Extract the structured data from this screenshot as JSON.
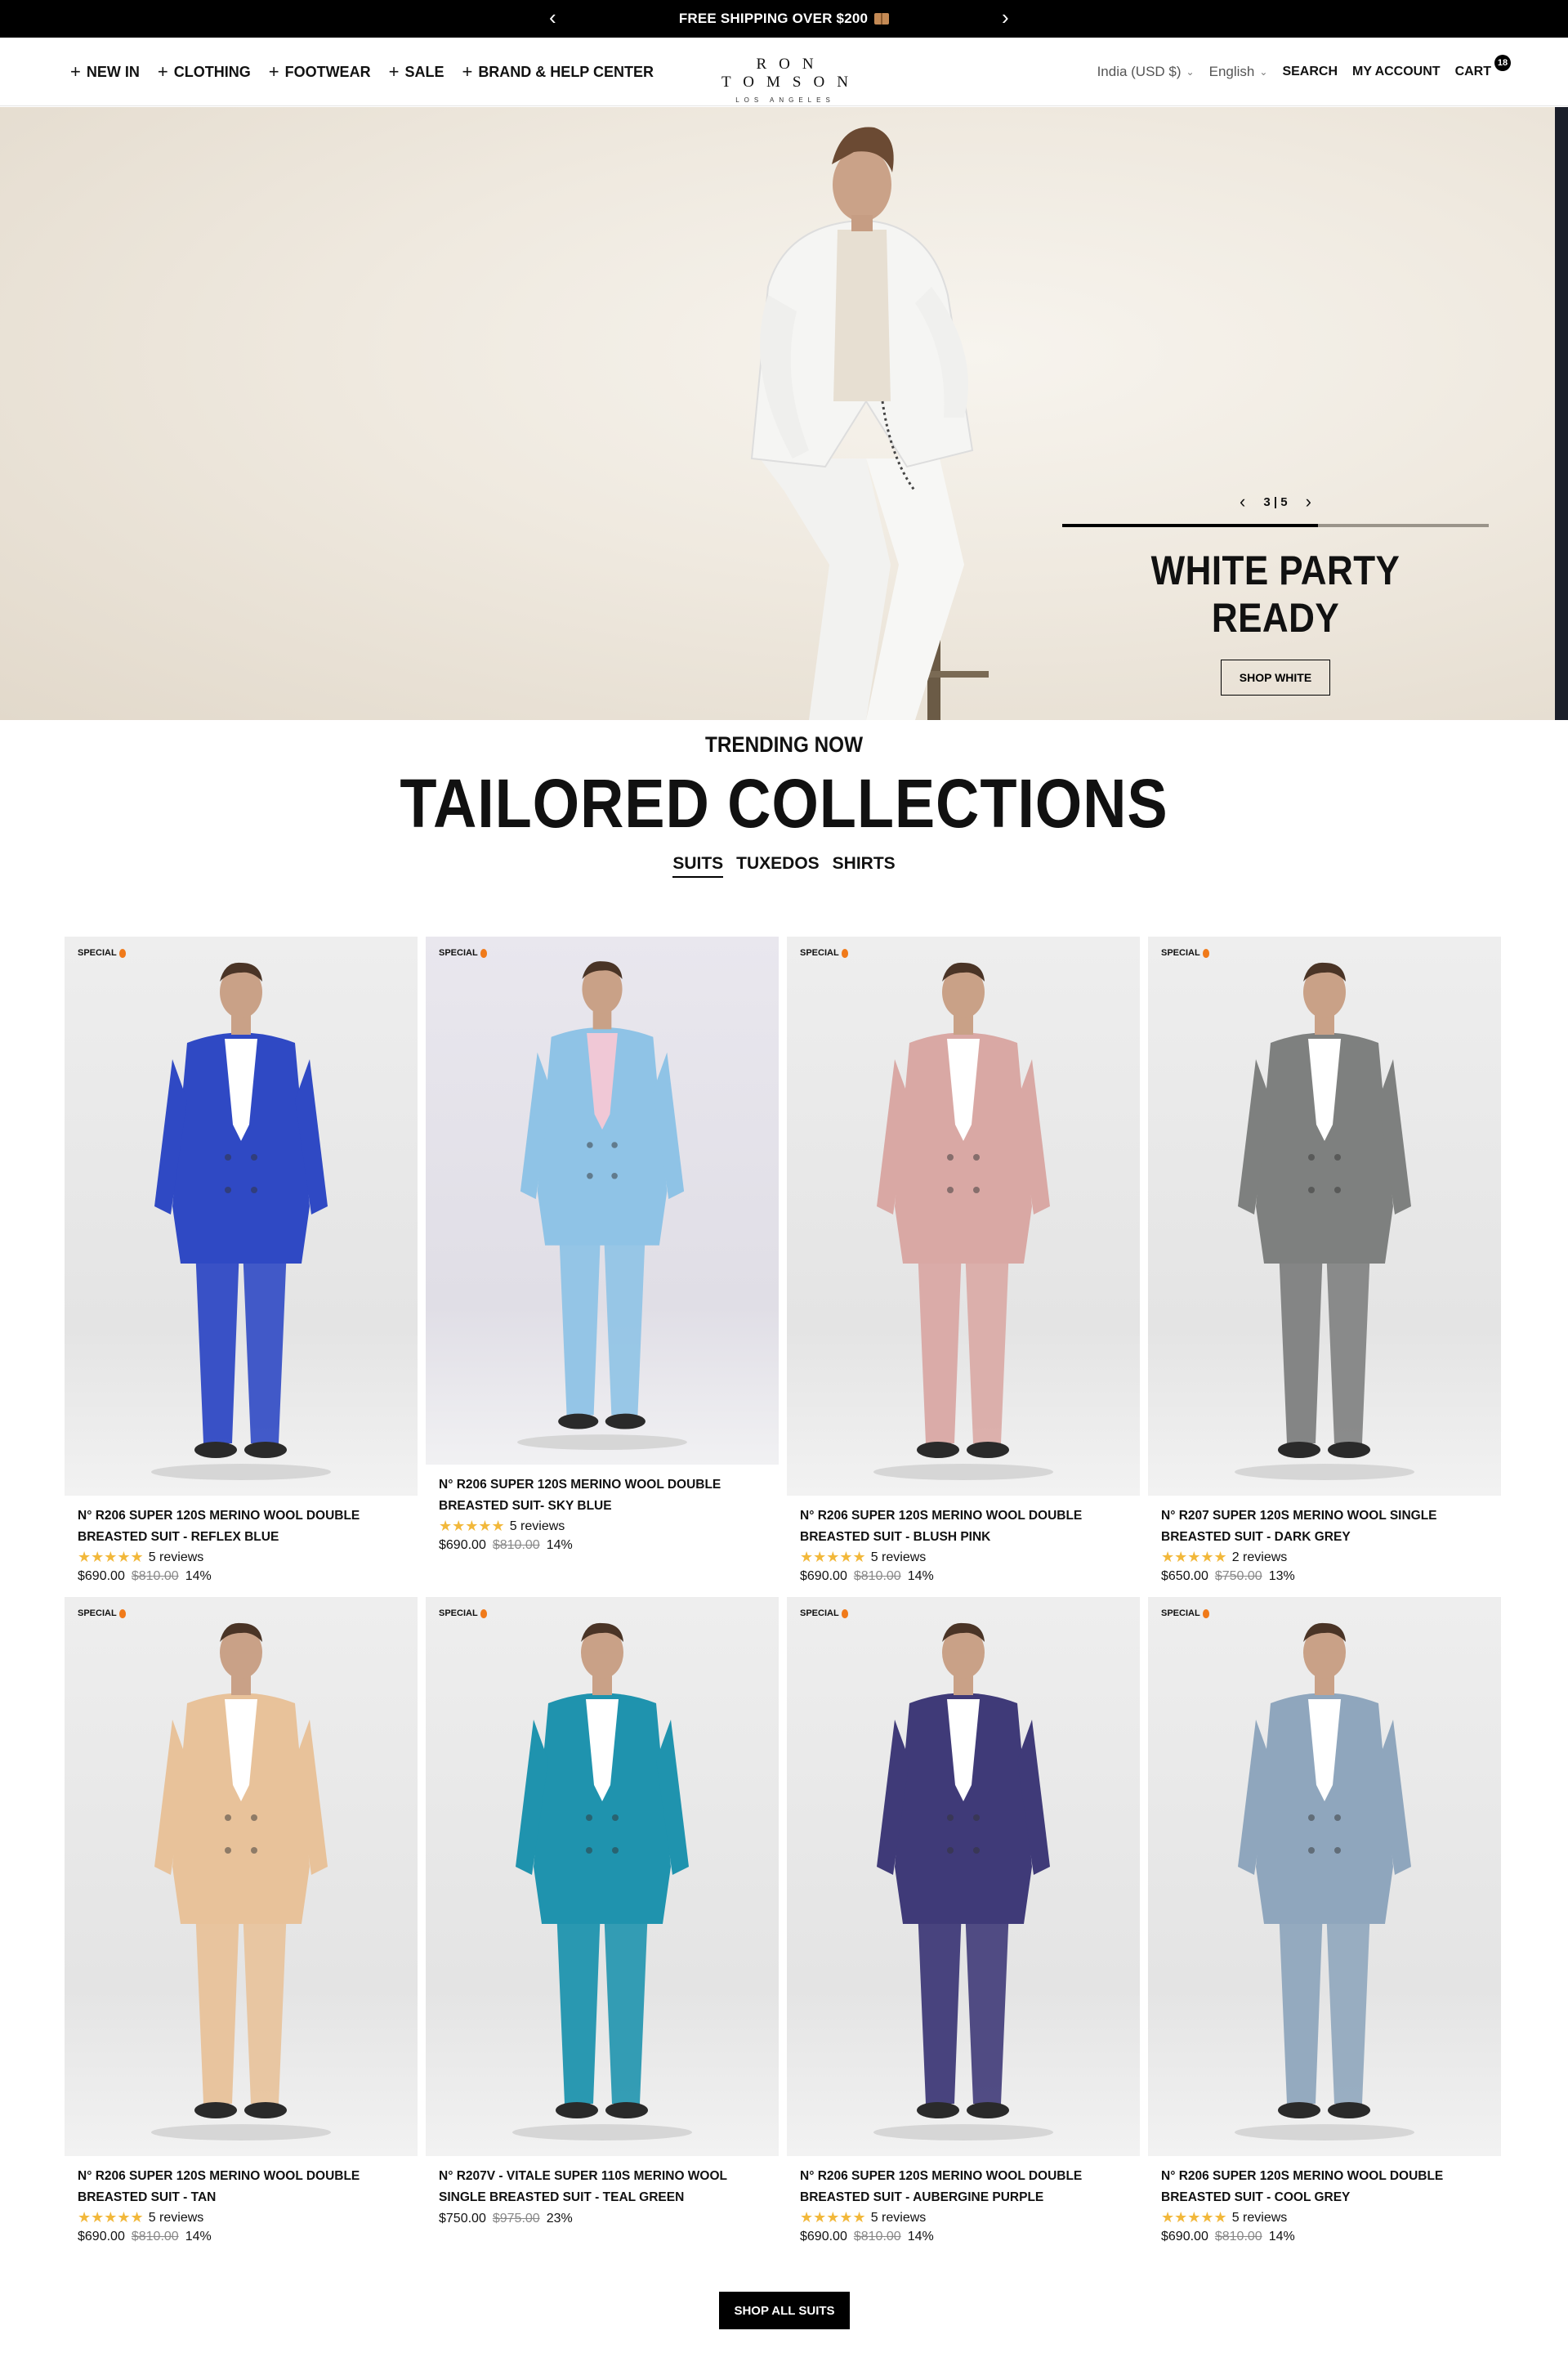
{
  "announcement": {
    "text": "FREE SHIPPING OVER $200",
    "icon": "package-icon"
  },
  "header": {
    "nav": [
      {
        "label": "NEW IN"
      },
      {
        "label": "CLOTHING"
      },
      {
        "label": "FOOTWEAR"
      },
      {
        "label": "SALE"
      },
      {
        "label": "BRAND & HELP CENTER"
      }
    ],
    "logo": {
      "main": "RON TOMSON",
      "sub": "LOS ANGELES"
    },
    "currency": "India (USD $)",
    "language": "English",
    "search_label": "SEARCH",
    "account_label": "MY ACCOUNT",
    "cart_label": "CART",
    "cart_count": "18"
  },
  "hero": {
    "pager": {
      "current": "3",
      "separator": "|",
      "total": "5"
    },
    "progress": 0.6,
    "title": "WHITE PARTY READY",
    "button": "SHOP WHITE"
  },
  "collections": {
    "kicker": "TRENDING NOW",
    "title": "TAILORED COLLECTIONS",
    "tabs": [
      {
        "label": "SUITS",
        "active": true
      },
      {
        "label": "TUXEDOS",
        "active": false
      },
      {
        "label": "SHIRTS",
        "active": false
      }
    ]
  },
  "products": [
    {
      "badge": "SPECIAL",
      "name": "N° R206 SUPER 120S MERINO WOOL DOUBLE BREASTED SUIT - REFLEX BLUE",
      "reviews": "5 reviews",
      "price": "$690.00",
      "was": "$810.00",
      "discount": "14%",
      "suit_color": "#2f49c4",
      "shirt_color": "#ffffff"
    },
    {
      "badge": "SPECIAL",
      "name": "N° R206 SUPER 120S MERINO WOOL DOUBLE BREASTED SUIT- SKY BLUE",
      "reviews": "5 reviews",
      "price": "$690.00",
      "was": "$810.00",
      "discount": "14%",
      "suit_color": "#8fc3e6",
      "shirt_color": "#f0c8d6"
    },
    {
      "badge": "SPECIAL",
      "name": "N° R206 SUPER 120S MERINO WOOL DOUBLE BREASTED SUIT - BLUSH PINK",
      "reviews": "5 reviews",
      "price": "$690.00",
      "was": "$810.00",
      "discount": "14%",
      "suit_color": "#d9a8a4",
      "shirt_color": "#ffffff"
    },
    {
      "badge": "SPECIAL",
      "name": "N° R207 SUPER 120S MERINO WOOL SINGLE BREASTED SUIT - DARK GREY",
      "reviews": "2 reviews",
      "price": "$650.00",
      "was": "$750.00",
      "discount": "13%",
      "suit_color": "#7e807f",
      "shirt_color": "#ffffff"
    },
    {
      "badge": "SPECIAL",
      "name": "N° R206 SUPER 120S MERINO WOOL DOUBLE BREASTED SUIT - TAN",
      "reviews": "5 reviews",
      "price": "$690.00",
      "was": "$810.00",
      "discount": "14%",
      "suit_color": "#e8c29a",
      "shirt_color": "#ffffff"
    },
    {
      "badge": "SPECIAL",
      "name": "N° R207V - VITALE SUPER 110S MERINO WOOL SINGLE BREASTED SUIT - TEAL GREEN",
      "reviews": "",
      "price": "$750.00",
      "was": "$975.00",
      "discount": "23%",
      "suit_color": "#1f93ae",
      "shirt_color": "#ffffff"
    },
    {
      "badge": "SPECIAL",
      "name": "N° R206 SUPER 120S MERINO WOOL DOUBLE BREASTED SUIT - AUBERGINE PURPLE",
      "reviews": "5 reviews",
      "price": "$690.00",
      "was": "$810.00",
      "discount": "14%",
      "suit_color": "#3f3a78",
      "shirt_color": "#ffffff"
    },
    {
      "badge": "SPECIAL",
      "name": "N° R206 SUPER 120S MERINO WOOL DOUBLE BREASTED SUIT - COOL GREY",
      "reviews": "5 reviews",
      "price": "$690.00",
      "was": "$810.00",
      "discount": "14%",
      "suit_color": "#8fa6bd",
      "shirt_color": "#ffffff"
    }
  ],
  "shop_all_label": "SHOP ALL SUITS"
}
